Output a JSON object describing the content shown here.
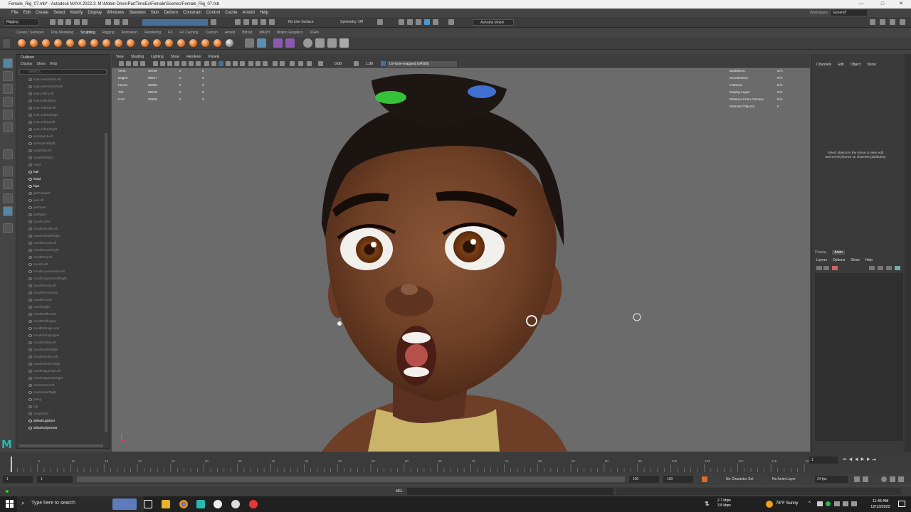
{
  "window": {
    "title": "Female_Rig_07.mb* - Autodesk MAYA 2022.3: M:\\Mobin Drive\\PartTimeEx\\Female\\Scenes\\Female_Rig_07.mb",
    "min": "—",
    "max": "□",
    "close": "✕"
  },
  "menus": [
    "File",
    "Edit",
    "Create",
    "Select",
    "Modify",
    "Display",
    "Windows",
    "Skeleton",
    "Skin",
    "Deform",
    "Constrain",
    "Control",
    "Cache",
    "Arnold",
    "Help"
  ],
  "workspace": {
    "label": "Workspace:",
    "value": "General*"
  },
  "status": {
    "mode": "Rigging",
    "live_surface": "No Live Surface",
    "symmetry": "Symmetry: Off",
    "user": "Ashraful Mobin"
  },
  "shelf_tabs": [
    "Curves / Surfaces",
    "Poly Modeling",
    "Sculpting",
    "Rigging",
    "Animation",
    "Rendering",
    "FX",
    "FX Caching",
    "Custom",
    "Arnold",
    "Bifrost",
    "MASH",
    "Motion Graphics",
    "XGen"
  ],
  "active_shelf": "Sculpting",
  "outliner": {
    "title": "Outliner",
    "menu": [
      "Display",
      "Show",
      "Help"
    ],
    "search": "Search...",
    "items": [
      "eyeLowerDownLeft",
      "eyeLowerDownRight",
      "eyeLookInLeft",
      "eyeLookInRight",
      "eyeLookOutLeft",
      "eyeLookOutRight",
      "eyeLookUpLeft",
      "eyeLookUpRight",
      "eyeSquintLeft",
      "eyeSquintRight",
      "eyeWideLeft",
      "eyeWideRight",
      "mesh",
      "hair",
      "head",
      "hips",
      "jawForward",
      "jawLeft",
      "jawOpen",
      "jawRight",
      "mouthClose",
      "mouthDimpleLeft",
      "mouthDimpleRight",
      "mouthFrownLeft",
      "mouthFrownRight",
      "mouthFunnel",
      "mouthLeft",
      "mouthLowerDownLeft",
      "mouthLowerDownRight",
      "mouthPressLeft",
      "mouthPressRight",
      "mouthPucker",
      "mouthRight",
      "mouthRollLower",
      "mouthRollUpper",
      "mouthShrugLower",
      "mouthShrugUpper",
      "mouthSmileLeft",
      "mouthSmileRight",
      "mouthStretchLeft",
      "mouthStretchRight",
      "mouthUpperUpLeft",
      "mouthUpperUpRight",
      "noseSneerLeft",
      "noseSneerRight",
      "persp",
      "top",
      "tongueOut",
      "defaultLightSet",
      "defaultObjectSet"
    ]
  },
  "viewport": {
    "menu": [
      "View",
      "Shading",
      "Lighting",
      "Show",
      "Renderer",
      "Panels"
    ],
    "val1": "0.00",
    "val2": "1.00",
    "colorspace": "Un-tone-mapped (sRGB)",
    "stats": [
      {
        "k": "Verts:",
        "v": "36758",
        "a": "0",
        "b": "0"
      },
      {
        "k": "Edges:",
        "v": "69817",
        "a": "0",
        "b": "0"
      },
      {
        "k": "Faces:",
        "v": "33300",
        "a": "0",
        "b": "0"
      },
      {
        "k": "Tris:",
        "v": "59748",
        "a": "0",
        "b": "0"
      },
      {
        "k": "UVs:",
        "v": "38168",
        "a": "0",
        "b": "0"
      }
    ],
    "info": [
      {
        "k": "Backfaces:",
        "v": "N/A"
      },
      {
        "k": "Smoothness:",
        "v": "N/A"
      },
      {
        "k": "Instance:",
        "v": "N/A"
      },
      {
        "k": "Display Layer:",
        "v": "N/A"
      },
      {
        "k": "Distance From Camera:",
        "v": "N/A"
      },
      {
        "k": "Selected Objects:",
        "v": "0"
      }
    ]
  },
  "channelbox": {
    "menu": [
      "Channels",
      "Edit",
      "Object",
      "Show"
    ],
    "hint": "Select objects in the scene to view, edit and set keyframes on channels (attributes)",
    "tabs": [
      "Display",
      "Anim"
    ],
    "layer_menu": [
      "Layers",
      "Options",
      "Show",
      "Help"
    ]
  },
  "timeline": {
    "ticks": [
      "5",
      "10",
      "15",
      "20",
      "25",
      "30",
      "35",
      "40",
      "45",
      "50",
      "55",
      "60",
      "65",
      "70",
      "75",
      "80",
      "85",
      "90",
      "95",
      "100",
      "105",
      "110",
      "115",
      "120"
    ],
    "current": "1"
  },
  "range": {
    "start": "1",
    "start2": "1",
    "end": "100",
    "end2": "100",
    "end3": "100",
    "char_set": "No Character Set",
    "anim_layer": "No Anim Layer",
    "fps": "24 fps"
  },
  "cmd": {
    "label": "MEL"
  },
  "taskbar": {
    "search": "Type here to search",
    "weather": "78°F Sunny",
    "net1": "2.7 kbps",
    "net2": "3.8 kbps",
    "time": "11:46 AM",
    "date": "12/13/2022"
  },
  "colors": {
    "accent": "#5285a6",
    "viewport": "#6b6b6b"
  }
}
